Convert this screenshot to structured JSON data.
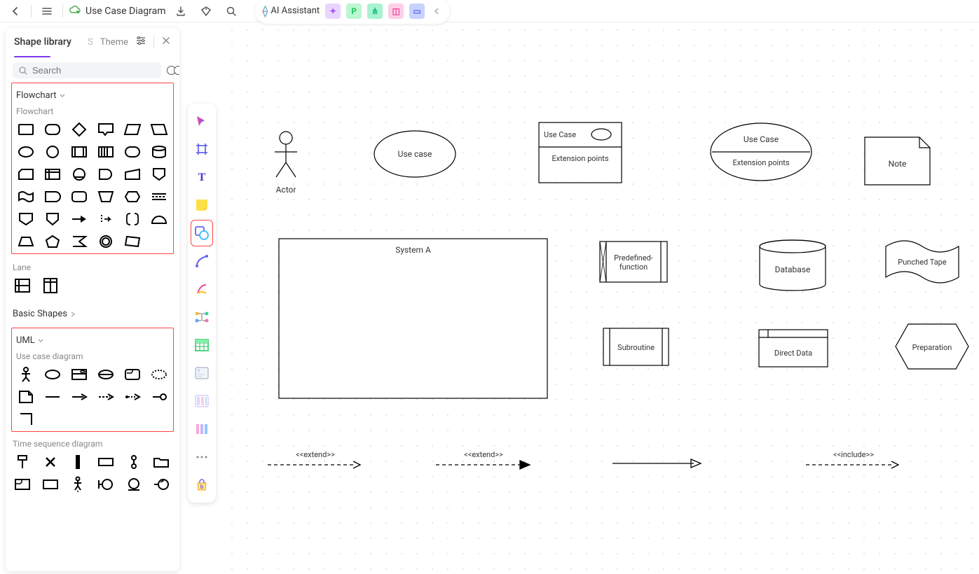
{
  "header": {
    "doc_title": "Use Case Diagram",
    "ai_label": "AI Assistant",
    "chips": [
      "",
      "P",
      "",
      "",
      ""
    ]
  },
  "panel": {
    "title": "Shape library",
    "tab_s": "S",
    "tab_theme": "Theme",
    "search_placeholder": "Search",
    "sections": {
      "flowchart": {
        "title": "Flowchart",
        "sub": "Flowchart"
      },
      "lane": {
        "sub": "Lane"
      },
      "basic": {
        "title": "Basic Shapes"
      },
      "uml": {
        "title": "UML",
        "sub": "Use case diagram"
      },
      "tsd": {
        "sub": "Time sequence diagram"
      }
    }
  },
  "canvas": {
    "actor": "Actor",
    "usecase": "Use case",
    "ucbox_title": "Use Case",
    "ucbox_ext": "Extension points",
    "ucell_title": "Use Case",
    "ucell_ext": "Extension points",
    "note": "Note",
    "systemA": "System A",
    "predef": "Predefined-function",
    "database": "Database",
    "punched": "Punched Tape",
    "subroutine": "Subroutine",
    "directdata": "Direct Data",
    "preparation": "Preparation",
    "extend1": "<<extend>>",
    "extend2": "<<extend>>",
    "include": "<<include>>"
  }
}
